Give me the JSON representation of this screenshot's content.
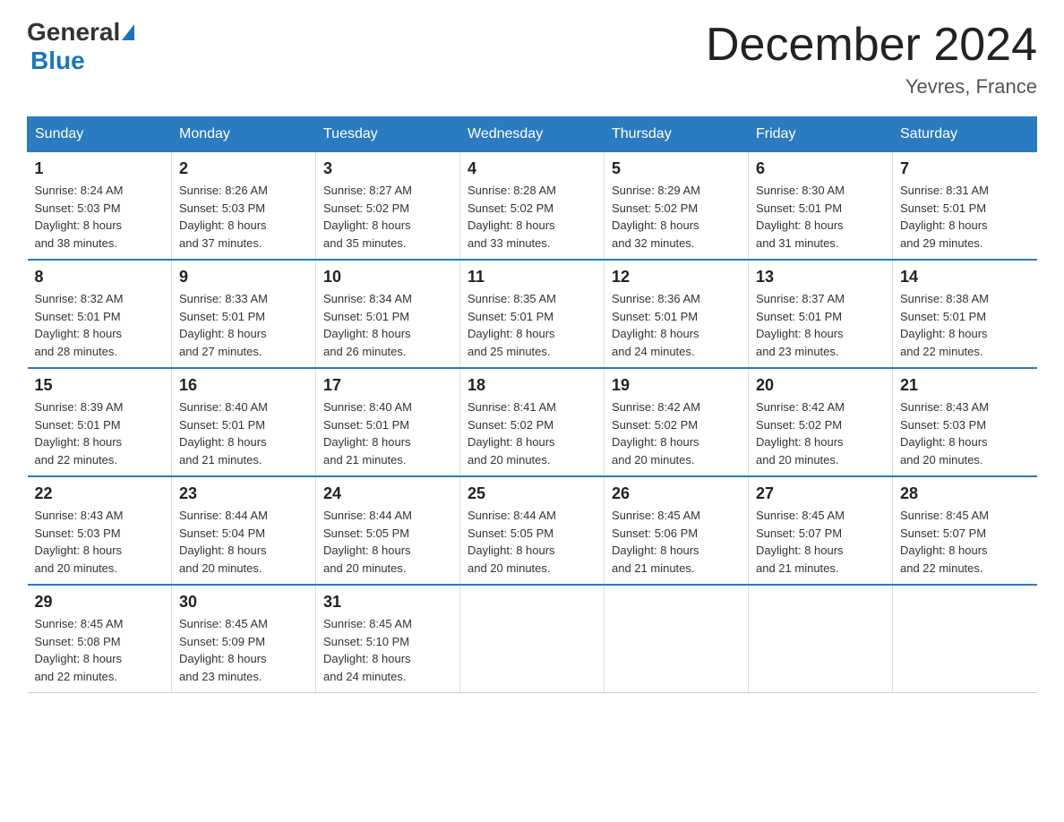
{
  "header": {
    "logo": {
      "general": "General",
      "blue": "Blue"
    },
    "title": "December 2024",
    "location": "Yevres, France"
  },
  "weekdays": [
    "Sunday",
    "Monday",
    "Tuesday",
    "Wednesday",
    "Thursday",
    "Friday",
    "Saturday"
  ],
  "weeks": [
    [
      {
        "day": "1",
        "sunrise": "8:24 AM",
        "sunset": "5:03 PM",
        "daylight": "8 hours and 38 minutes."
      },
      {
        "day": "2",
        "sunrise": "8:26 AM",
        "sunset": "5:03 PM",
        "daylight": "8 hours and 37 minutes."
      },
      {
        "day": "3",
        "sunrise": "8:27 AM",
        "sunset": "5:02 PM",
        "daylight": "8 hours and 35 minutes."
      },
      {
        "day": "4",
        "sunrise": "8:28 AM",
        "sunset": "5:02 PM",
        "daylight": "8 hours and 33 minutes."
      },
      {
        "day": "5",
        "sunrise": "8:29 AM",
        "sunset": "5:02 PM",
        "daylight": "8 hours and 32 minutes."
      },
      {
        "day": "6",
        "sunrise": "8:30 AM",
        "sunset": "5:01 PM",
        "daylight": "8 hours and 31 minutes."
      },
      {
        "day": "7",
        "sunrise": "8:31 AM",
        "sunset": "5:01 PM",
        "daylight": "8 hours and 29 minutes."
      }
    ],
    [
      {
        "day": "8",
        "sunrise": "8:32 AM",
        "sunset": "5:01 PM",
        "daylight": "8 hours and 28 minutes."
      },
      {
        "day": "9",
        "sunrise": "8:33 AM",
        "sunset": "5:01 PM",
        "daylight": "8 hours and 27 minutes."
      },
      {
        "day": "10",
        "sunrise": "8:34 AM",
        "sunset": "5:01 PM",
        "daylight": "8 hours and 26 minutes."
      },
      {
        "day": "11",
        "sunrise": "8:35 AM",
        "sunset": "5:01 PM",
        "daylight": "8 hours and 25 minutes."
      },
      {
        "day": "12",
        "sunrise": "8:36 AM",
        "sunset": "5:01 PM",
        "daylight": "8 hours and 24 minutes."
      },
      {
        "day": "13",
        "sunrise": "8:37 AM",
        "sunset": "5:01 PM",
        "daylight": "8 hours and 23 minutes."
      },
      {
        "day": "14",
        "sunrise": "8:38 AM",
        "sunset": "5:01 PM",
        "daylight": "8 hours and 22 minutes."
      }
    ],
    [
      {
        "day": "15",
        "sunrise": "8:39 AM",
        "sunset": "5:01 PM",
        "daylight": "8 hours and 22 minutes."
      },
      {
        "day": "16",
        "sunrise": "8:40 AM",
        "sunset": "5:01 PM",
        "daylight": "8 hours and 21 minutes."
      },
      {
        "day": "17",
        "sunrise": "8:40 AM",
        "sunset": "5:01 PM",
        "daylight": "8 hours and 21 minutes."
      },
      {
        "day": "18",
        "sunrise": "8:41 AM",
        "sunset": "5:02 PM",
        "daylight": "8 hours and 20 minutes."
      },
      {
        "day": "19",
        "sunrise": "8:42 AM",
        "sunset": "5:02 PM",
        "daylight": "8 hours and 20 minutes."
      },
      {
        "day": "20",
        "sunrise": "8:42 AM",
        "sunset": "5:02 PM",
        "daylight": "8 hours and 20 minutes."
      },
      {
        "day": "21",
        "sunrise": "8:43 AM",
        "sunset": "5:03 PM",
        "daylight": "8 hours and 20 minutes."
      }
    ],
    [
      {
        "day": "22",
        "sunrise": "8:43 AM",
        "sunset": "5:03 PM",
        "daylight": "8 hours and 20 minutes."
      },
      {
        "day": "23",
        "sunrise": "8:44 AM",
        "sunset": "5:04 PM",
        "daylight": "8 hours and 20 minutes."
      },
      {
        "day": "24",
        "sunrise": "8:44 AM",
        "sunset": "5:05 PM",
        "daylight": "8 hours and 20 minutes."
      },
      {
        "day": "25",
        "sunrise": "8:44 AM",
        "sunset": "5:05 PM",
        "daylight": "8 hours and 20 minutes."
      },
      {
        "day": "26",
        "sunrise": "8:45 AM",
        "sunset": "5:06 PM",
        "daylight": "8 hours and 21 minutes."
      },
      {
        "day": "27",
        "sunrise": "8:45 AM",
        "sunset": "5:07 PM",
        "daylight": "8 hours and 21 minutes."
      },
      {
        "day": "28",
        "sunrise": "8:45 AM",
        "sunset": "5:07 PM",
        "daylight": "8 hours and 22 minutes."
      }
    ],
    [
      {
        "day": "29",
        "sunrise": "8:45 AM",
        "sunset": "5:08 PM",
        "daylight": "8 hours and 22 minutes."
      },
      {
        "day": "30",
        "sunrise": "8:45 AM",
        "sunset": "5:09 PM",
        "daylight": "8 hours and 23 minutes."
      },
      {
        "day": "31",
        "sunrise": "8:45 AM",
        "sunset": "5:10 PM",
        "daylight": "8 hours and 24 minutes."
      },
      null,
      null,
      null,
      null
    ]
  ],
  "labels": {
    "sunrise": "Sunrise:",
    "sunset": "Sunset:",
    "daylight": "Daylight:"
  }
}
